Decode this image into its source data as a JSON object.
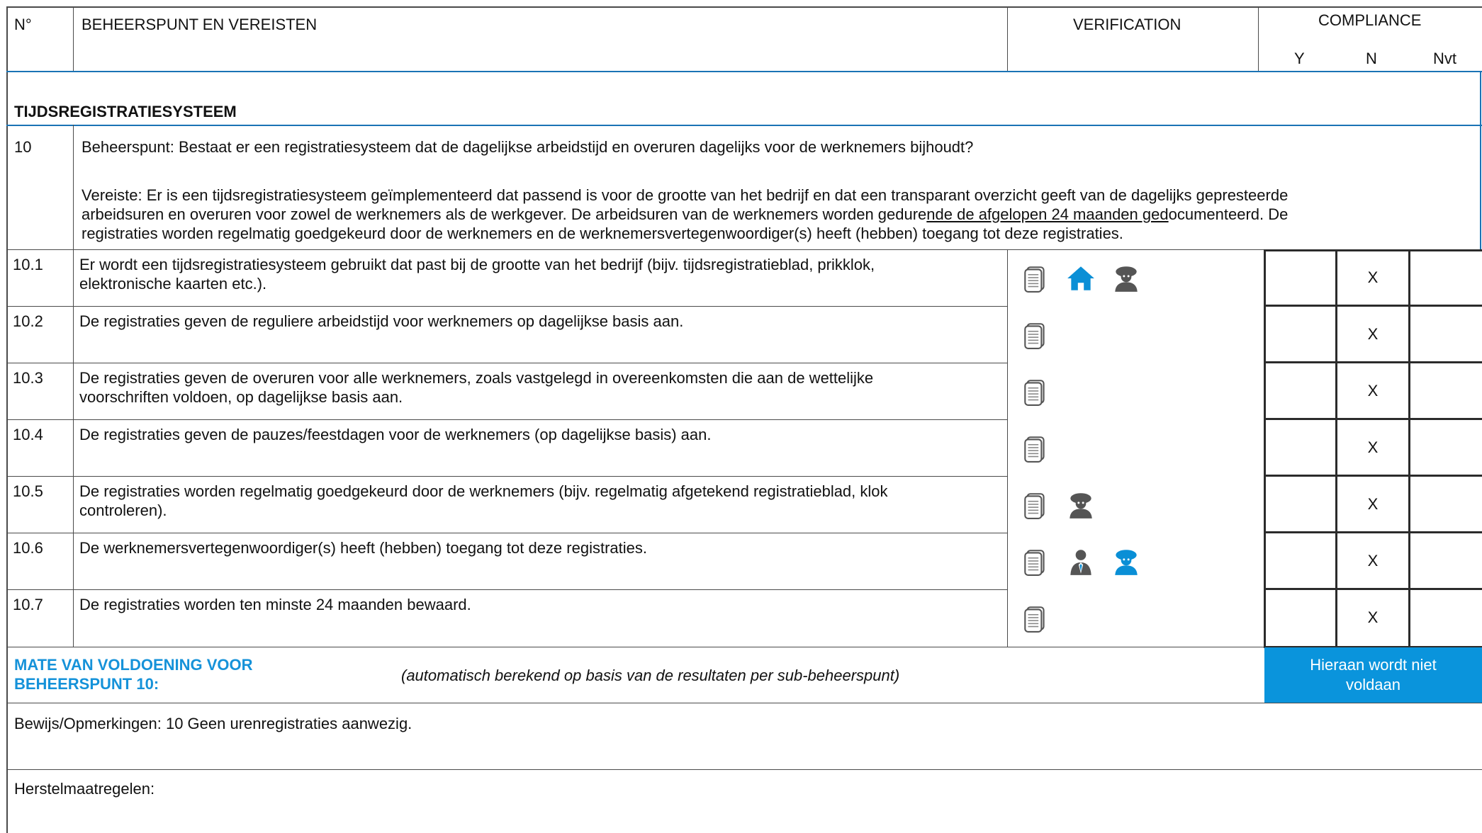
{
  "header": {
    "col_no": "N°",
    "col_requirements": "BEHEERSPUNT EN VEREISTEN",
    "col_verification": "VERIFICATION",
    "col_compliance": "COMPLIANCE",
    "col_y": "Y",
    "col_n": "N",
    "col_nvt": "Nvt"
  },
  "section_title": "TIJDSREGISTRATIESYSTEEM",
  "control_point": {
    "number": "10",
    "question": "Beheerspunt: Bestaat er een registratiesysteem dat de dagelijkse arbeidstijd en overuren dagelijks voor de werknemers bijhoudt?",
    "requirement_line1": "Vereiste: Er is een tijdsregistratiesysteem geïmplementeerd dat passend is voor de grootte van het bedrijf en dat een transparant overzicht geeft van de dagelijks gepresteerde",
    "requirement_line2_a": "arbeidsuren en overuren voor zowel de werknemers als de werkgever. De arbeidsuren van de werknemers worden gedure",
    "requirement_line2_b": "nde de afgelopen 24 maanden ged",
    "requirement_line2_c": "ocumenteerd. De",
    "requirement_line3": "registraties worden regelmatig goedgekeurd door de werknemers en de werknemersvertegenwoordiger(s) heeft (hebben) toegang tot deze registraties."
  },
  "rows": [
    {
      "number": "10.1",
      "text_l1": "Er wordt een tijdsregistratiesysteem gebruikt dat past bij de grootte van het bedrijf (bijv. tijdsregistratieblad, prikklok,",
      "text_l2": "elektronische kaarten etc.).",
      "icons": [
        "document-icon",
        "home-icon",
        "worker-icon"
      ],
      "y": "",
      "n": "X",
      "nvt": ""
    },
    {
      "number": "10.2",
      "text_l1": "De registraties geven de reguliere arbeidstijd voor werknemers op dagelijkse basis aan.",
      "text_l2": "",
      "icons": [
        "document-icon"
      ],
      "y": "",
      "n": "X",
      "nvt": ""
    },
    {
      "number": "10.3",
      "text_l1": "De registraties geven de overuren voor alle werknemers, zoals vastgelegd in overeenkomsten die aan de wettelijke",
      "text_l2": "voorschriften voldoen, op dagelijkse basis aan.",
      "icons": [
        "document-icon"
      ],
      "y": "",
      "n": "X",
      "nvt": ""
    },
    {
      "number": "10.4",
      "text_l1": "De registraties geven de pauzes/feestdagen voor de werknemers (op dagelijkse basis) aan.",
      "text_l2": "",
      "icons": [
        "document-icon"
      ],
      "y": "",
      "n": "X",
      "nvt": ""
    },
    {
      "number": "10.5",
      "text_l1": "De registraties worden regelmatig goedgekeurd door de werknemers (bijv. regelmatig afgetekend registratieblad, klok",
      "text_l2": "controleren).",
      "icons": [
        "document-icon",
        "worker-icon"
      ],
      "y": "",
      "n": "X",
      "nvt": ""
    },
    {
      "number": "10.6",
      "text_l1": "De werknemersvertegenwoordiger(s) heeft (hebben) toegang tot deze registraties.",
      "text_l2": "",
      "icons": [
        "document-icon",
        "manager-icon",
        "worker-blue-icon"
      ],
      "y": "",
      "n": "X",
      "nvt": ""
    },
    {
      "number": "10.7",
      "text_l1": "De registraties worden ten minste 24 maanden bewaard.",
      "text_l2": "",
      "icons": [
        "document-icon"
      ],
      "y": "",
      "n": "X",
      "nvt": ""
    }
  ],
  "summary": {
    "label_l1": "MATE VAN VOLDOENING VOOR",
    "label_l2": "BEHEERSPUNT 10:",
    "note": "(automatisch berekend op basis van de resultaten per sub-beheerspunt)",
    "result_l1": "Hieraan wordt niet",
    "result_l2": "voldaan"
  },
  "evidence": "Bewijs/Opmerkingen: 10 Geen urenregistraties aanwezig.",
  "remedial": "Herstelmaatregelen:",
  "colors": {
    "accent": "#1592d9",
    "result_bg": "#0a94dc",
    "icon_grey": "#555555",
    "icon_blue": "#0a8fd6",
    "grid_blue": "#1a73b5"
  }
}
